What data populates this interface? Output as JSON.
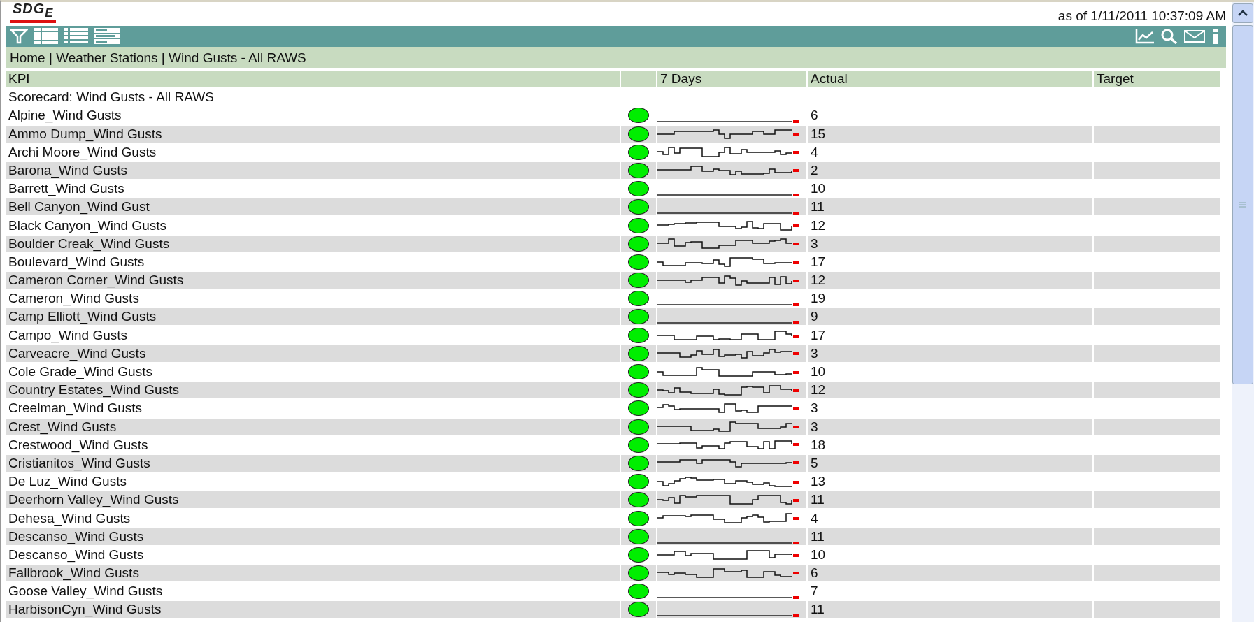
{
  "logo": "SDG$_{E}$",
  "timestamp": "as of 1/11/2011 10:37:09 AM",
  "breadcrumb": "Home | Weather Stations | Wind Gusts - All RAWS",
  "table": {
    "columns": [
      "KPI",
      "7 Days",
      "Actual",
      "Target"
    ],
    "section": "Scorecard: Wind Gusts - All RAWS",
    "rows": [
      {
        "name": "Alpine_Wind Gusts",
        "color": "#00ee00",
        "kind": "flat",
        "actual": "6"
      },
      {
        "name": "Ammo Dump_Wind Gusts",
        "color": "#00ee00",
        "kind": "steps",
        "actual": "15"
      },
      {
        "name": "Archi Moore_Wind Gusts",
        "color": "#00ee00",
        "kind": "steps",
        "actual": "4"
      },
      {
        "name": "Barona_Wind Gusts",
        "color": "#00ee00",
        "kind": "steps",
        "actual": "2"
      },
      {
        "name": "Barrett_Wind Gusts",
        "color": "#00ee00",
        "kind": "flat",
        "actual": "10"
      },
      {
        "name": "Bell Canyon_Wind Gust",
        "color": "#00ee00",
        "kind": "flat",
        "actual": "11"
      },
      {
        "name": "Black Canyon_Wind Gusts",
        "color": "#00ee00",
        "kind": "steps",
        "actual": "12"
      },
      {
        "name": "Boulder Creak_Wind Gusts",
        "color": "#00ee00",
        "kind": "steps",
        "actual": "3"
      },
      {
        "name": "Boulevard_Wind Gusts",
        "color": "#00ee00",
        "kind": "steps",
        "actual": "17"
      },
      {
        "name": "Cameron Corner_Wind Gusts",
        "color": "#00ee00",
        "kind": "steps",
        "actual": "12"
      },
      {
        "name": "Cameron_Wind Gusts",
        "color": "#00ee00",
        "kind": "flat",
        "actual": "19"
      },
      {
        "name": "Camp Elliott_Wind Gusts",
        "color": "#00ee00",
        "kind": "flat",
        "actual": "9"
      },
      {
        "name": "Campo_Wind Gusts",
        "color": "#00ee00",
        "kind": "steps",
        "actual": "17"
      },
      {
        "name": "Carveacre_Wind Gusts",
        "color": "#00ee00",
        "kind": "steps",
        "actual": "3"
      },
      {
        "name": "Cole Grade_Wind Gusts",
        "color": "#00ee00",
        "kind": "steps",
        "actual": "10"
      },
      {
        "name": "Country Estates_Wind Gusts",
        "color": "#00ee00",
        "kind": "steps",
        "actual": "12"
      },
      {
        "name": "Creelman_Wind Gusts",
        "color": "#00ee00",
        "kind": "steps",
        "actual": "3"
      },
      {
        "name": "Crest_Wind Gusts",
        "color": "#00ee00",
        "kind": "steps",
        "actual": "3"
      },
      {
        "name": "Crestwood_Wind Gusts",
        "color": "#00ee00",
        "kind": "steps",
        "actual": "18"
      },
      {
        "name": "Cristianitos_Wind Gusts",
        "color": "#00ee00",
        "kind": "steps",
        "actual": "5"
      },
      {
        "name": "De Luz_Wind Gusts",
        "color": "#00ee00",
        "kind": "steps",
        "actual": "13"
      },
      {
        "name": "Deerhorn Valley_Wind Gusts",
        "color": "#00ee00",
        "kind": "steps",
        "actual": "11"
      },
      {
        "name": "Dehesa_Wind Gusts",
        "color": "#00ee00",
        "kind": "steps",
        "actual": "4"
      },
      {
        "name": "Descanso_Wind Gusts",
        "color": "#00ee00",
        "kind": "flat",
        "actual": "11"
      },
      {
        "name": "Descanso_Wind Gusts",
        "color": "#00ee00",
        "kind": "steps",
        "actual": "10"
      },
      {
        "name": "Fallbrook_Wind Gusts",
        "color": "#00ee00",
        "kind": "steps",
        "actual": "6"
      },
      {
        "name": "Goose Valley_Wind Gusts",
        "color": "#00ee00",
        "kind": "flat",
        "actual": "7"
      },
      {
        "name": "HarbisonCyn_Wind Gusts",
        "color": "#00ee00",
        "kind": "flat",
        "actual": "11"
      }
    ]
  }
}
